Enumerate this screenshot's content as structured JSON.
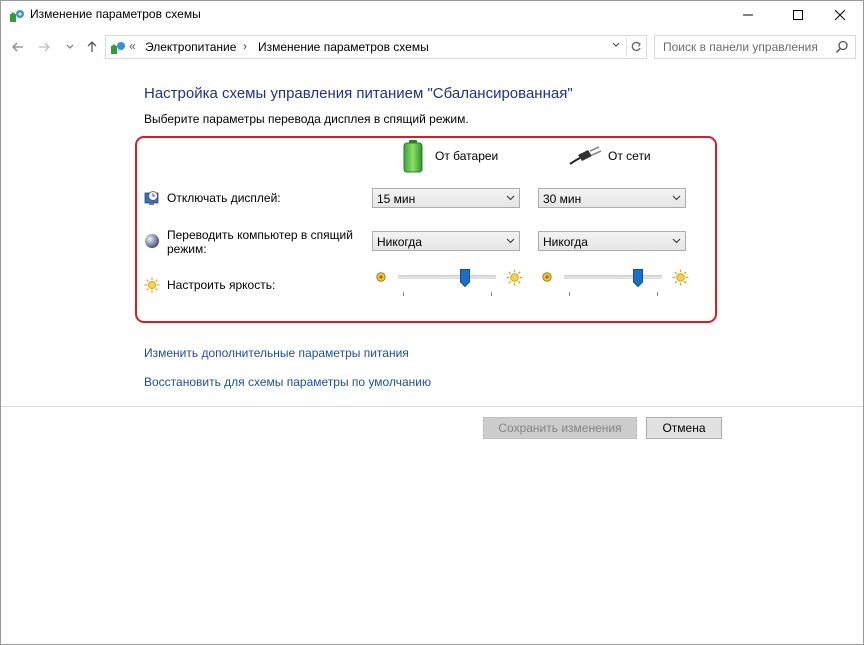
{
  "window": {
    "title": "Изменение параметров схемы"
  },
  "address": {
    "crumb_prefix": "«",
    "crumbs": [
      "Электропитание",
      "Изменение параметров схемы"
    ],
    "separator": "›"
  },
  "search": {
    "placeholder": "Поиск в панели управления"
  },
  "main": {
    "heading": "Настройка схемы управления питанием \"Сбалансированная\"",
    "subheading": "Выберите параметры перевода дисплея в спящий режим."
  },
  "columns": {
    "battery": "От батареи",
    "plugged": "От сети"
  },
  "rows": {
    "display_off": {
      "label": "Отключать дисплей:",
      "battery": "15 мин",
      "plugged": "30 мин"
    },
    "sleep": {
      "label_line1": "Переводить компьютер в спящий",
      "label_line2": "режим:",
      "battery": "Никогда",
      "plugged": "Никогда"
    },
    "brightness": {
      "label": "Настроить яркость:",
      "battery_level": 0.68,
      "plugged_level": 0.75
    }
  },
  "links": {
    "advanced": "Изменить дополнительные параметры питания",
    "restore": "Восстановить для схемы параметры по умолчанию"
  },
  "buttons": {
    "save": "Сохранить изменения",
    "cancel": "Отмена"
  },
  "icons": {
    "title": "power-options-icon",
    "battery": "battery-icon",
    "plug": "power-plug-icon",
    "display": "monitor-clock-icon",
    "sleep": "moon-icon",
    "brightness": "sun-icon"
  },
  "colors": {
    "heading": "#1e3287",
    "link": "#1a4f9e",
    "highlight_frame": "#d41f2b",
    "slider_thumb": "#1b6fc9"
  }
}
